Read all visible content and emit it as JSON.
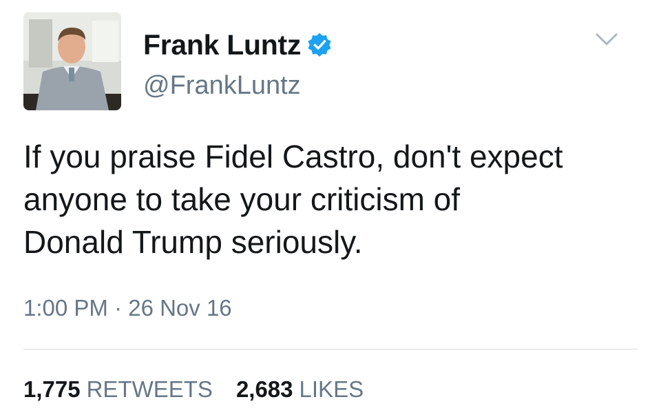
{
  "author": {
    "display_name": "Frank Luntz",
    "handle": "@FrankLuntz",
    "verified": true,
    "avatar_icon": "profile-photo",
    "verified_color": "#1da1f2"
  },
  "tweet": {
    "text": "If you praise Fidel Castro, don't expect\nanyone to take your criticism of\nDonald Trump seriously.",
    "timestamp": "1:00 PM · 26 Nov 16"
  },
  "stats": {
    "retweets_count": "1,775",
    "retweets_label": "RETWEETS",
    "likes_count": "2,683",
    "likes_label": "LIKES"
  },
  "icons": {
    "menu": "chevron-down-icon",
    "verified": "verified-badge-icon"
  }
}
